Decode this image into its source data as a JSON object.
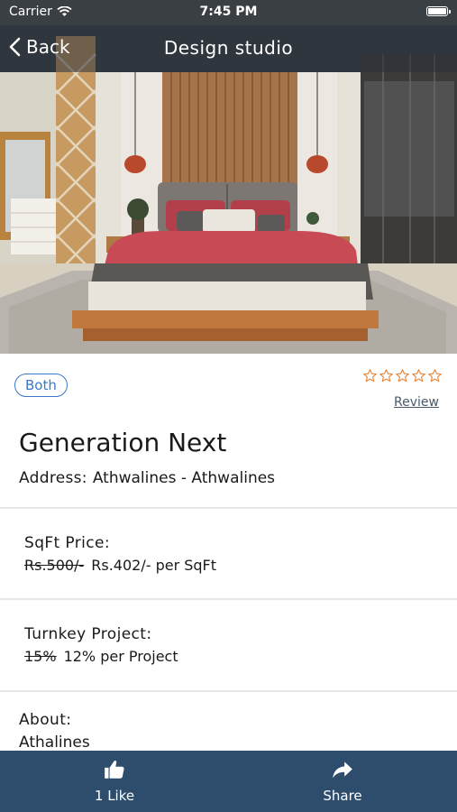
{
  "status_bar": {
    "carrier": "Carrier",
    "time": "7:45 PM"
  },
  "nav": {
    "back_label": "Back",
    "title": "Design studio"
  },
  "hero": {
    "image_description": "bedroom-interior-photo"
  },
  "listing": {
    "type_badge": "Both",
    "rating": 0,
    "rating_max": 5,
    "review_link": "Review",
    "name": "Generation Next",
    "address_label": "Address:",
    "address_value": "Athwalines - Athwalines"
  },
  "sqft": {
    "title": "SqFt Price:",
    "old_price": "Rs.500/-",
    "new_price": "Rs.402/- per SqFt"
  },
  "turnkey": {
    "title": "Turnkey Project:",
    "old_price": "15%",
    "new_price": "12% per Project"
  },
  "about": {
    "title": "About:",
    "text": "Athalines"
  },
  "bottom": {
    "like_label": "1 Like",
    "share_label": "Share"
  },
  "colors": {
    "accent_blue": "#3a78c9",
    "star_orange": "#e8873a",
    "bottom_bar": "#2e4d6c"
  }
}
